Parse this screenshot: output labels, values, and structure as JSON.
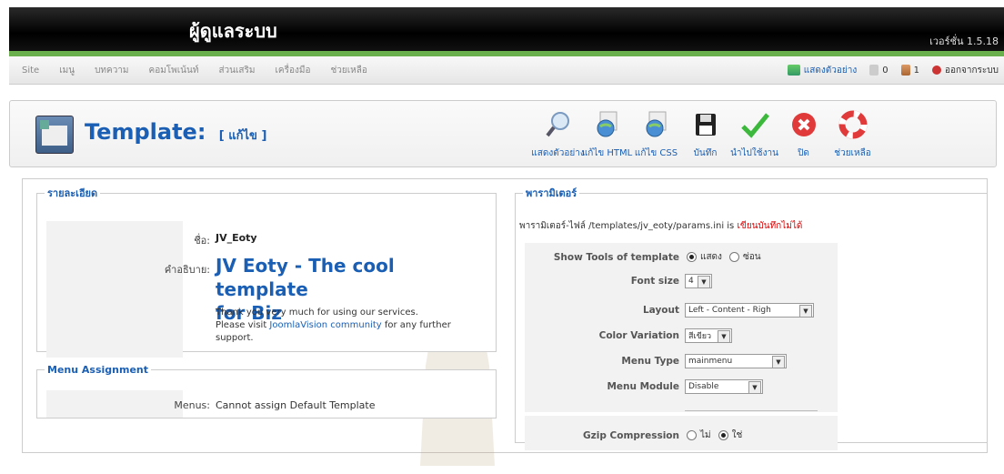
{
  "header": {
    "title": "ผู้ดูแลระบบ",
    "version": "เวอร์ชั่น 1.5.18"
  },
  "menubar": {
    "items": [
      "Site",
      "เมนู",
      "บทความ",
      "คอมโพเน้นท์",
      "ส่วนเสริม",
      "เครื่องมือ",
      "ช่วยเหลือ"
    ],
    "preview": "แสดงตัวอย่าง",
    "count_a": "0",
    "count_b": "1",
    "logout": "ออกจากระบบ"
  },
  "page": {
    "title": "Template:",
    "subtitle": "[ แก้ไข ]"
  },
  "toolbar": {
    "preview": "แสดงตัวอย่าง",
    "edit_html": "แก้ไข HTML",
    "edit_css": "แก้ไข CSS",
    "save": "บันทึก",
    "apply": "นำไปใช้งาน",
    "close": "ปิด",
    "help": "ช่วยเหลือ"
  },
  "details": {
    "legend": "รายละเอียด",
    "name_label": "ชื่อ:",
    "name_value": "JV_Eoty",
    "desc_label": "คำอธิบาย:",
    "desc_title_1": "JV Eoty - The cool template",
    "desc_title_2": "for Biz",
    "desc_line1": "Thank you very much for using our services.",
    "desc_line2_a": "Please visit ",
    "desc_link": "JoomlaVision community",
    "desc_line2_b": " for any further",
    "desc_line3": "support."
  },
  "menu_assignment": {
    "legend": "Menu Assignment",
    "label": "Menus:",
    "value": "Cannot assign Default Template"
  },
  "params": {
    "legend": "พารามิเตอร์",
    "note_a": "พารามิเตอร์-ไฟล์ /templates/jv_eoty/params.ini is ",
    "note_b": "เขียนบันทึกไม่ได้",
    "show_tools_label": "Show Tools of template",
    "show_tools_opt1": "แสดง",
    "show_tools_opt2": "ซ่อน",
    "font_size_label": "Font size",
    "font_size_value": "4",
    "layout_label": "Layout",
    "layout_value": "Left - Content - Righ",
    "color_label": "Color Variation",
    "color_value": "สีเขียว",
    "menu_type_label": "Menu Type",
    "menu_type_value": "mainmenu",
    "menu_module_label": "Menu Module",
    "menu_module_value": "Disable",
    "gzip_label": "Gzip Compression",
    "gzip_opt1": "ไม่",
    "gzip_opt2": "ใช่"
  }
}
